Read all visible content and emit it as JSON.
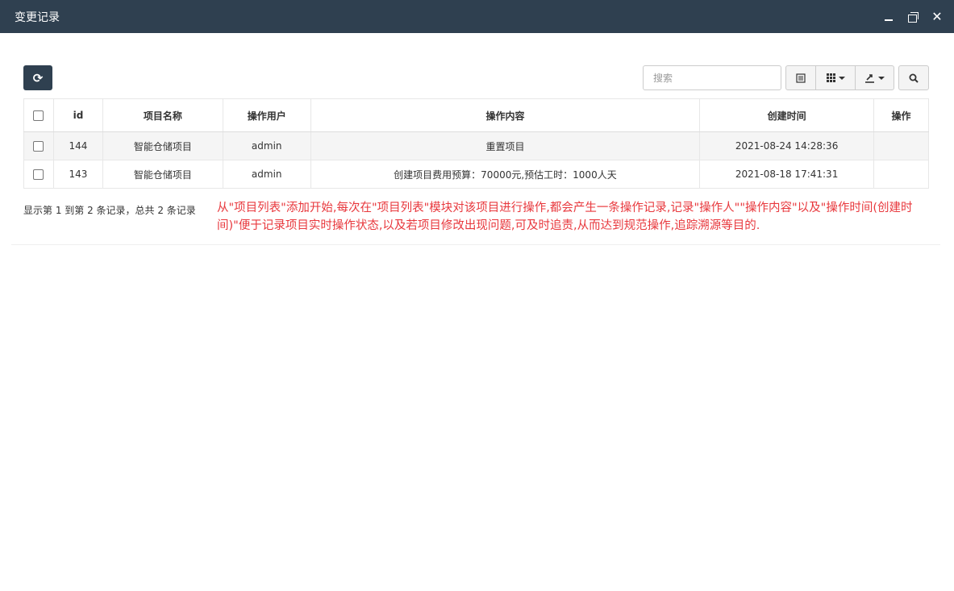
{
  "window": {
    "title": "变更记录"
  },
  "toolbar": {
    "search_placeholder": "搜索",
    "refresh_icon": "refresh-icon",
    "list_icon": "list-icon",
    "columns_icon": "grid-icon",
    "export_icon": "export-icon",
    "search_icon": "search-icon"
  },
  "table": {
    "headers": [
      "id",
      "项目名称",
      "操作用户",
      "操作内容",
      "创建时间",
      "操作"
    ],
    "rows": [
      {
        "id": "144",
        "project": "智能仓储项目",
        "user": "admin",
        "content": "重置项目",
        "created": "2021-08-24 14:28:36",
        "action": ""
      },
      {
        "id": "143",
        "project": "智能仓储项目",
        "user": "admin",
        "content": "创建项目费用预算：70000元,预估工时：1000人天",
        "created": "2021-08-18 17:41:31",
        "action": ""
      }
    ]
  },
  "pagination": {
    "info": "显示第 1 到第 2 条记录，总共 2 条记录"
  },
  "annotation": "从\"项目列表\"添加开始,每次在\"项目列表\"模块对该项目进行操作,都会产生一条操作记录,记录\"操作人\"\"操作内容\"以及\"操作时间(创建时间)\"便于记录项目实时操作状态,以及若项目修改出现问题,可及时追责,从而达到规范操作,追踪溯源等目的.",
  "colors": {
    "titlebar": "#2f4050",
    "annotation": "#e8383d"
  }
}
